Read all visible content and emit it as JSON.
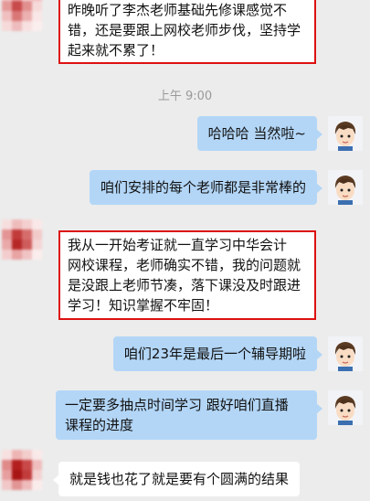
{
  "time_divider": "上午 9:00",
  "icons": {
    "self_avatar": "cartoon-boy-avatar-icon",
    "other_avatar": "pixelated-avatar-icon"
  },
  "colors": {
    "background": "#ececec",
    "out_bubble": "#b3d6f7",
    "in_bubble": "#ffffff",
    "highlight_border": "#dd1111"
  },
  "messages": [
    {
      "id": "m1",
      "side": "in",
      "highlighted": true,
      "lines": [
        "昨晚听了李杰老师基础先修课感觉不",
        "错，还是要跟上网校老师步伐，坚持学",
        "起来就不累了！"
      ]
    },
    {
      "id": "m2",
      "side": "out",
      "text": "哈哈哈 当然啦~"
    },
    {
      "id": "m3",
      "side": "out",
      "text": "咱们安排的每个老师都是非常棒的"
    },
    {
      "id": "m4",
      "side": "in",
      "highlighted": true,
      "lines": [
        "我从一开始考证就一直学习中华会计",
        "网校课程，老师确实不错，我的问题就",
        "是没跟上老师节凑，落下课没及时跟进",
        "学习！知识掌握不牢固！"
      ]
    },
    {
      "id": "m5",
      "side": "out",
      "text": "咱们23年是最后一个辅导期啦"
    },
    {
      "id": "m6",
      "side": "out",
      "lines": [
        "一定要多抽点时间学习  跟好咱们直播",
        "课程的进度"
      ]
    },
    {
      "id": "m7",
      "side": "in",
      "text": "就是钱也花了就是要有个圆满的结果"
    }
  ]
}
